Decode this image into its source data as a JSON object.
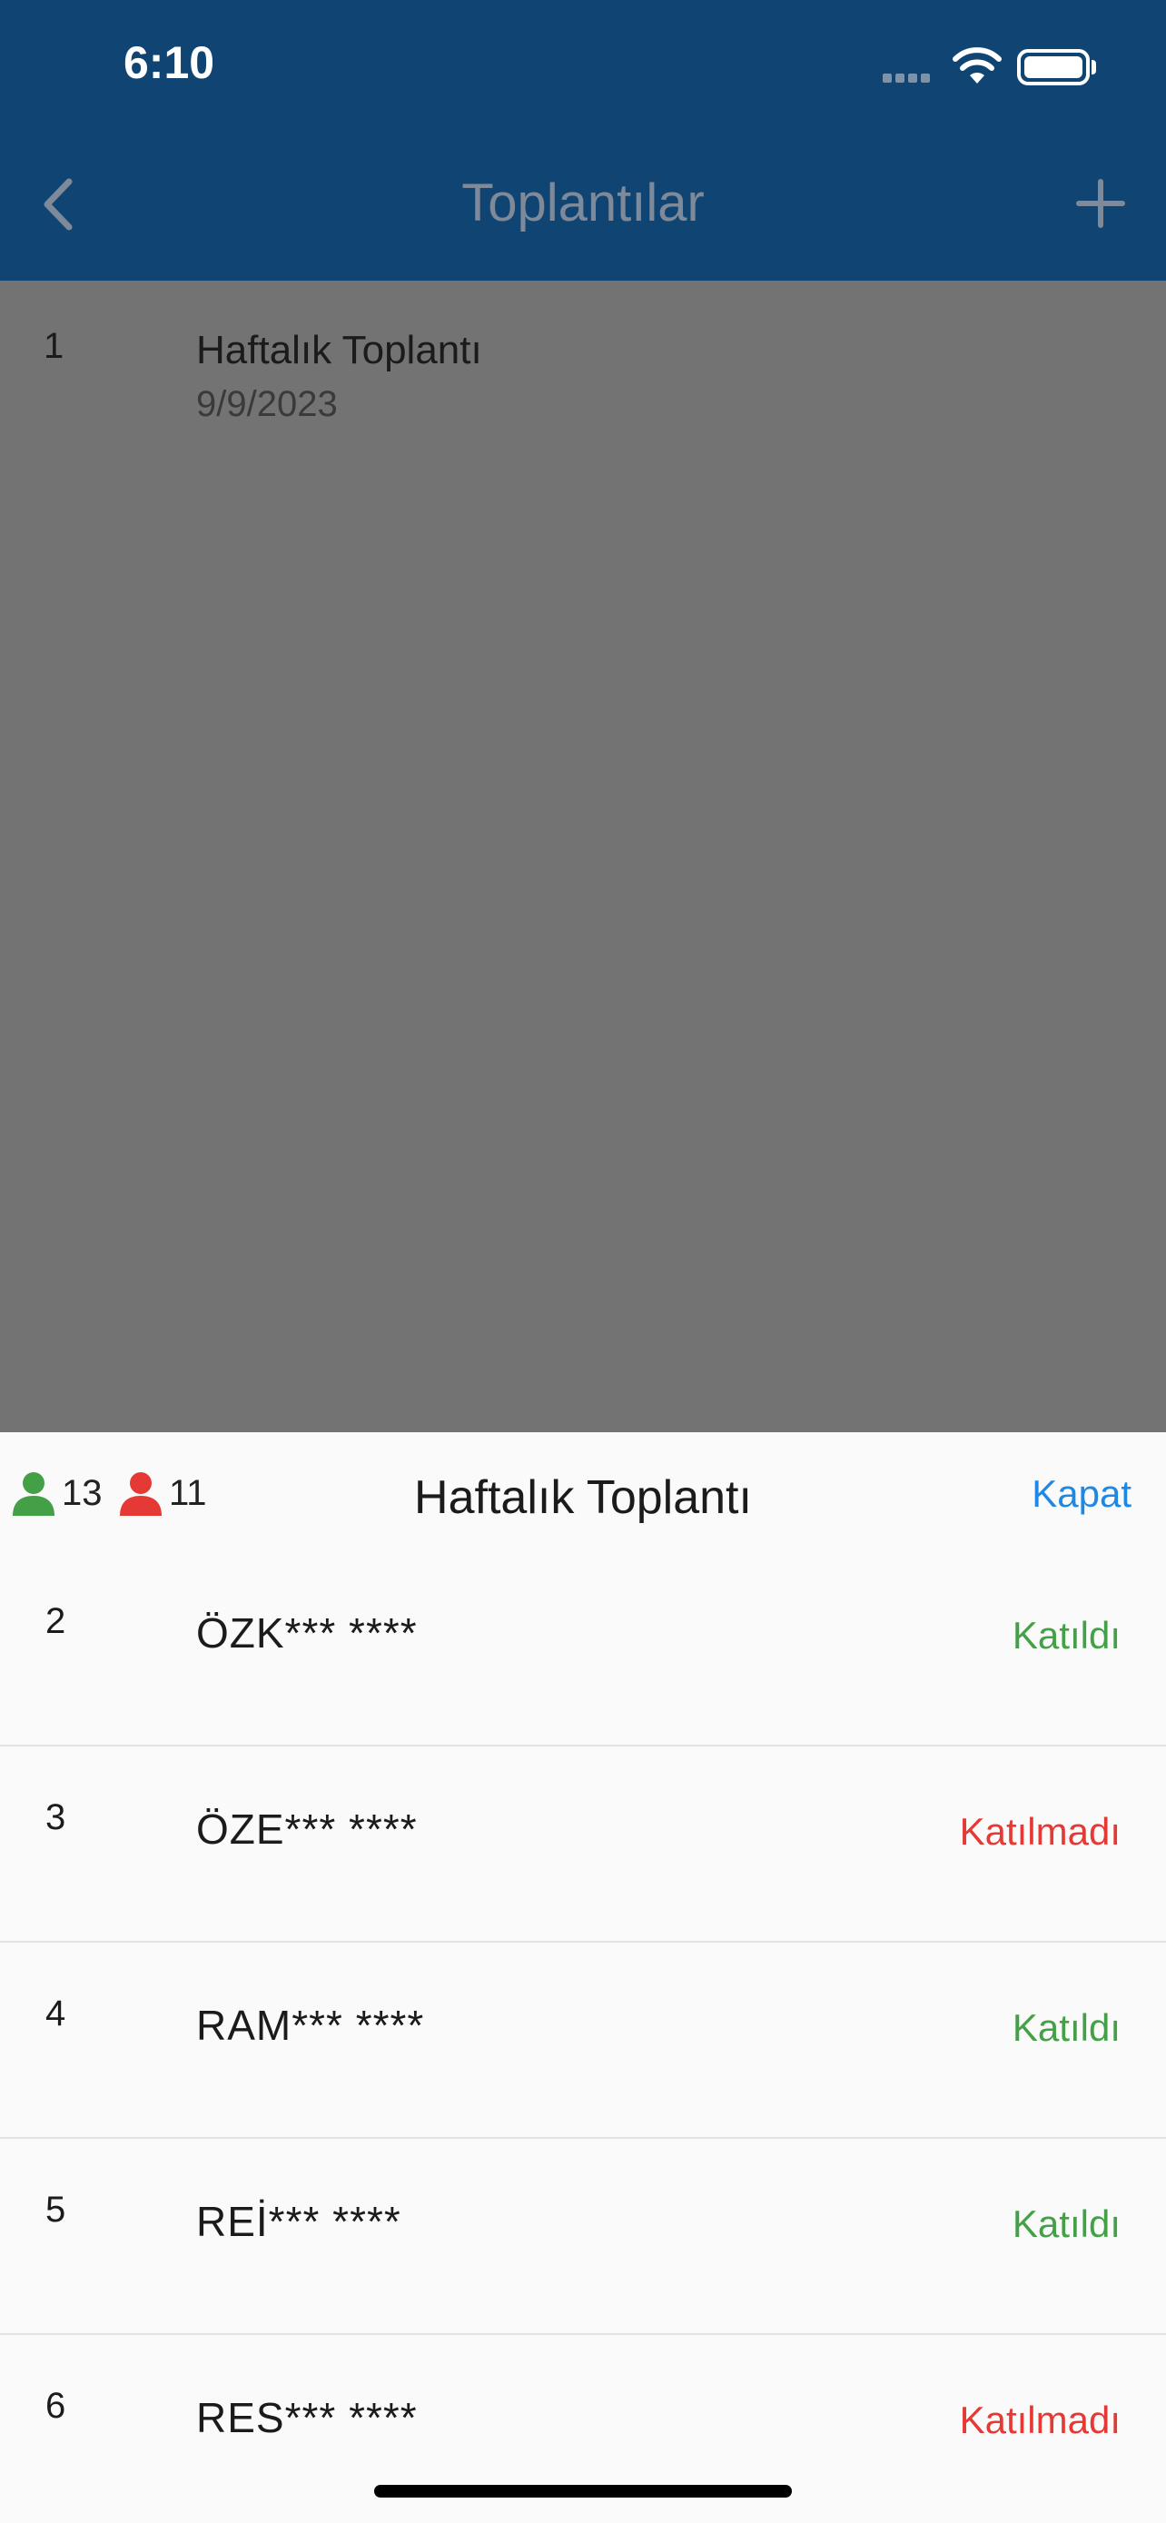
{
  "status_bar": {
    "time": "6:10"
  },
  "nav": {
    "title": "Toplantılar",
    "back_icon": "chevron-left-icon",
    "add_icon": "plus-icon"
  },
  "meetings": [
    {
      "index": "1",
      "title": "Haftalık Toplantı",
      "date": "9/9/2023"
    }
  ],
  "sheet": {
    "title": "Haftalık Toplantı",
    "close_label": "Kapat",
    "attended_count": "13",
    "absent_count": "11",
    "colors": {
      "attended": "#43a047",
      "absent": "#e53935",
      "accent": "#1e88e5"
    },
    "attendees": [
      {
        "index": "2",
        "name": "ÖZK*** ****",
        "status": "Katıldı",
        "attended": true
      },
      {
        "index": "3",
        "name": "ÖZE*** ****",
        "status": "Katılmadı",
        "attended": false
      },
      {
        "index": "4",
        "name": "RAM*** ****",
        "status": "Katıldı",
        "attended": true
      },
      {
        "index": "5",
        "name": "REİ*** ****",
        "status": "Katıldı",
        "attended": true
      },
      {
        "index": "6",
        "name": "RES*** ****",
        "status": "Katılmadı",
        "attended": false
      }
    ]
  }
}
